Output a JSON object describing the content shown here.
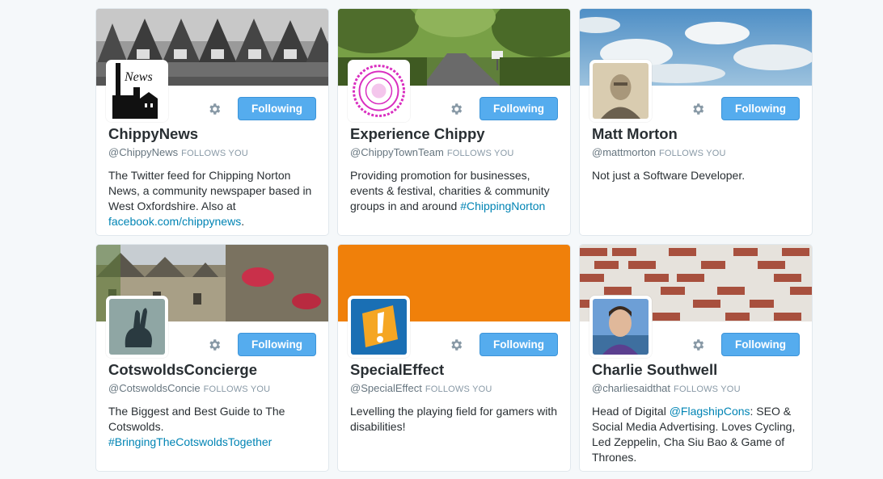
{
  "follow_button_label": "Following",
  "follows_you_label": "FOLLOWS YOU",
  "colors": {
    "button_blue": "#55acee",
    "link_blue": "#0084b4",
    "orange_banner": "#f0800a"
  },
  "cards": [
    {
      "name": "ChippyNews",
      "handle": "@ChippyNews",
      "follows_you": true,
      "bio_parts": [
        {
          "text": "The Twitter feed for Chipping Norton News, a community newspaper based in West Oxfordshire. Also at "
        },
        {
          "link": "facebook.com/chippynews"
        },
        {
          "text": "."
        }
      ],
      "avatar_text": "News"
    },
    {
      "name": "Experience Chippy",
      "handle": "@ChippyTownTeam",
      "follows_you": true,
      "bio_parts": [
        {
          "text": "Providing promotion for businesses, events & festival, charities & community groups in and around "
        },
        {
          "link": "#ChippingNorton"
        }
      ]
    },
    {
      "name": "Matt Morton",
      "handle": "@mattmorton",
      "follows_you": true,
      "bio_parts": [
        {
          "text": "Not just a Software Developer."
        }
      ]
    },
    {
      "name": "CotswoldsConcierge",
      "handle": "@CotswoldsConcie",
      "follows_you": true,
      "bio_parts": [
        {
          "text": "The Biggest and Best Guide to The Cotswolds. "
        },
        {
          "link": "#BringingTheCotswoldsTogether"
        }
      ]
    },
    {
      "name": "SpecialEffect",
      "handle": "@SpecialEffect",
      "follows_you": true,
      "bio_parts": [
        {
          "text": "Levelling the playing field for gamers with disabilities!"
        }
      ]
    },
    {
      "name": "Charlie Southwell",
      "handle": "@charliesaidthat",
      "follows_you": true,
      "bio_parts": [
        {
          "text": "Head of Digital "
        },
        {
          "link": "@FlagshipCons"
        },
        {
          "text": ": SEO & Social Media Advertising. Loves Cycling, Led Zeppelin, Cha Siu Bao & Game of Thrones."
        }
      ]
    }
  ]
}
